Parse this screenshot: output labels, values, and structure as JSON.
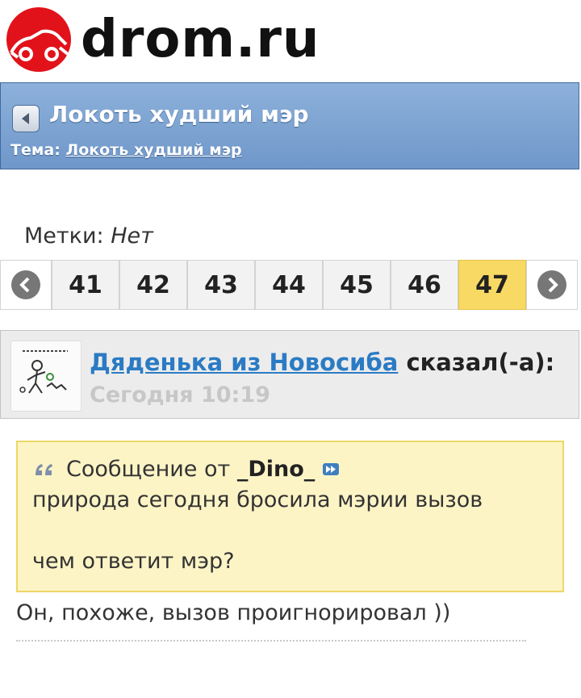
{
  "header": {
    "logo_text": "drom.ru",
    "logo_color": "#e2121b"
  },
  "topic": {
    "title": "Локоть худший мэр",
    "subject_label": "Тема:",
    "subject_link": "Локоть худший мэр"
  },
  "tags": {
    "label": "Метки:",
    "value": "Нет"
  },
  "pagination": {
    "pages": [
      "41",
      "42",
      "43",
      "44",
      "45",
      "46",
      "47"
    ],
    "current": "47",
    "current_color": "#f8d964"
  },
  "post": {
    "author": "Дяденька из Новосиба",
    "said": "сказал(-а):",
    "time": "Сегодня 10:19",
    "quote": {
      "prefix": "Сообщение от",
      "author": "_Dino_",
      "line1": "природа сегодня бросила мэрии вызов",
      "line2": "чем ответит мэр?"
    },
    "reply": "Он, похоже, вызов проигнорировал ))"
  }
}
